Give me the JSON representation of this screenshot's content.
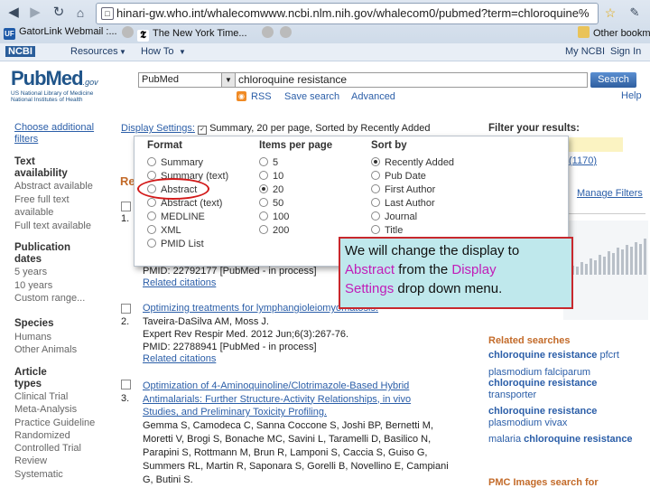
{
  "browser": {
    "url": "hinari-gw.who.int/whalecomwww.ncbi.nlm.nih.gov/whalecom0/pubmed?term=chloroquine%",
    "bookmarks": [
      "GatorLink Webmail :...",
      "The New York Time...",
      "Other bookm"
    ]
  },
  "ncbi_bar": {
    "ncbi": "NCBI",
    "resources": "Resources",
    "howto": "How To",
    "myncbi": "My NCBI",
    "signin": "Sign In"
  },
  "header": {
    "logo": "PubMed",
    "logo_gov": ".gov",
    "logo_sub1": "US National Library of Medicine",
    "logo_sub2": "National Institutes of Health",
    "db": "PubMed",
    "query": "chloroquine resistance",
    "search_button": "Search",
    "rss": "RSS",
    "save_search": "Save search",
    "advanced": "Advanced",
    "help": "Help"
  },
  "sidebar": {
    "choose_filters": "Choose additional filters",
    "text_avail_head": "Text availability",
    "text_avail": [
      "Abstract available",
      "Free full text available",
      "Full text available"
    ],
    "pub_dates_head": "Publication dates",
    "pub_dates": [
      "5 years",
      "10 years",
      "Custom range..."
    ],
    "species_head": "Species",
    "species": [
      "Humans",
      "Other Animals"
    ],
    "article_types_head": "Article types",
    "article_types": [
      "Clinical Trial",
      "Meta-Analysis",
      "Practice Guideline",
      "Randomized Controlled Trial",
      "Review",
      "Systematic"
    ]
  },
  "display_settings": {
    "label": "Display Settings:",
    "summary": "Summary, 20 per page, Sorted by Recently Added"
  },
  "dropdown": {
    "format_head": "Format",
    "format": [
      "Summary",
      "Summary (text)",
      "Abstract",
      "Abstract (text)",
      "MEDLINE",
      "XML",
      "PMID List"
    ],
    "items_head": "Items per page",
    "items": [
      "5",
      "10",
      "20",
      "50",
      "100",
      "200"
    ],
    "sort_head": "Sort by",
    "sort": [
      "Recently Added",
      "Pub Date",
      "First Author",
      "Last Author",
      "Journal",
      "Title"
    ]
  },
  "results": {
    "partial_heading": "Re",
    "r1_num": "1.",
    "r1_pmid": "PMID: 22792177 [PubMed - in process]",
    "r1_related": "Related citations",
    "r2_num": "2.",
    "r2_title": "Optimizing treatments for lymphangioleiomyomatosis.",
    "r2_authors": "Taveira-DaSilva AM, Moss J.",
    "r2_source": "Expert Rev Respir Med. 2012 Jun;6(3):267-76.",
    "r2_pmid": "PMID: 22788941 [PubMed - in process]",
    "r2_related": "Related citations",
    "r3_num": "3.",
    "r3_title": [
      "Optimization of 4-Aminoquinoline/Clotrimazole-Based Hybrid",
      "Antimalarials: Further Structure-Activity Relationships, in vivo",
      "Studies, and Preliminary Toxicity Profiling."
    ],
    "r3_authors": [
      "Gemma S, Camodeca C, Sanna Coccone S, Joshi BP, Bernetti M,",
      "Moretti V, Brogi S, Bonache MC, Savini L, Taramelli D, Basilico N,",
      "Parapini S, Rottmann M, Brun R, Lamponi S, Caccia S, Guiso G,",
      "Summers RL, Martin R, Saponara S, Gorelli B, Novellino E, Campiani",
      "G, Butini S."
    ]
  },
  "callout": {
    "t1": "We will change the display to",
    "t2_hl": "Abstract",
    "t3": " from the ",
    "t4_hl": "Display",
    "t5_hl": "Settings",
    "t6": " drop down menu."
  },
  "right": {
    "filter_head": "Filter your results:",
    "count": "(1170)",
    "manage_filters": "Manage Filters",
    "related_head": "Related searches",
    "searches": [
      {
        "bold": "chloroquine resistance",
        "rest": " pfcrt"
      },
      {
        "bold": "",
        "rest": "plasmodium falciparum "
      },
      {
        "bold": "chloroquine resistance",
        "rest": ""
      },
      {
        "bold": "",
        "rest": "transporter"
      },
      {
        "bold": "chloroquine resistance",
        "rest": ""
      },
      {
        "bold": "",
        "rest": "plasmodium vivax"
      },
      {
        "bold": "",
        "rest": "malaria "
      }
    ],
    "malaria_bold": "chloroquine resistance",
    "pmc_head": "PMC Images search for"
  },
  "colors": {
    "accent": "#2b5ea8",
    "callout_bg": "#bfe8ec",
    "callout_border": "#c8282d",
    "highlight": "#c11db8"
  }
}
